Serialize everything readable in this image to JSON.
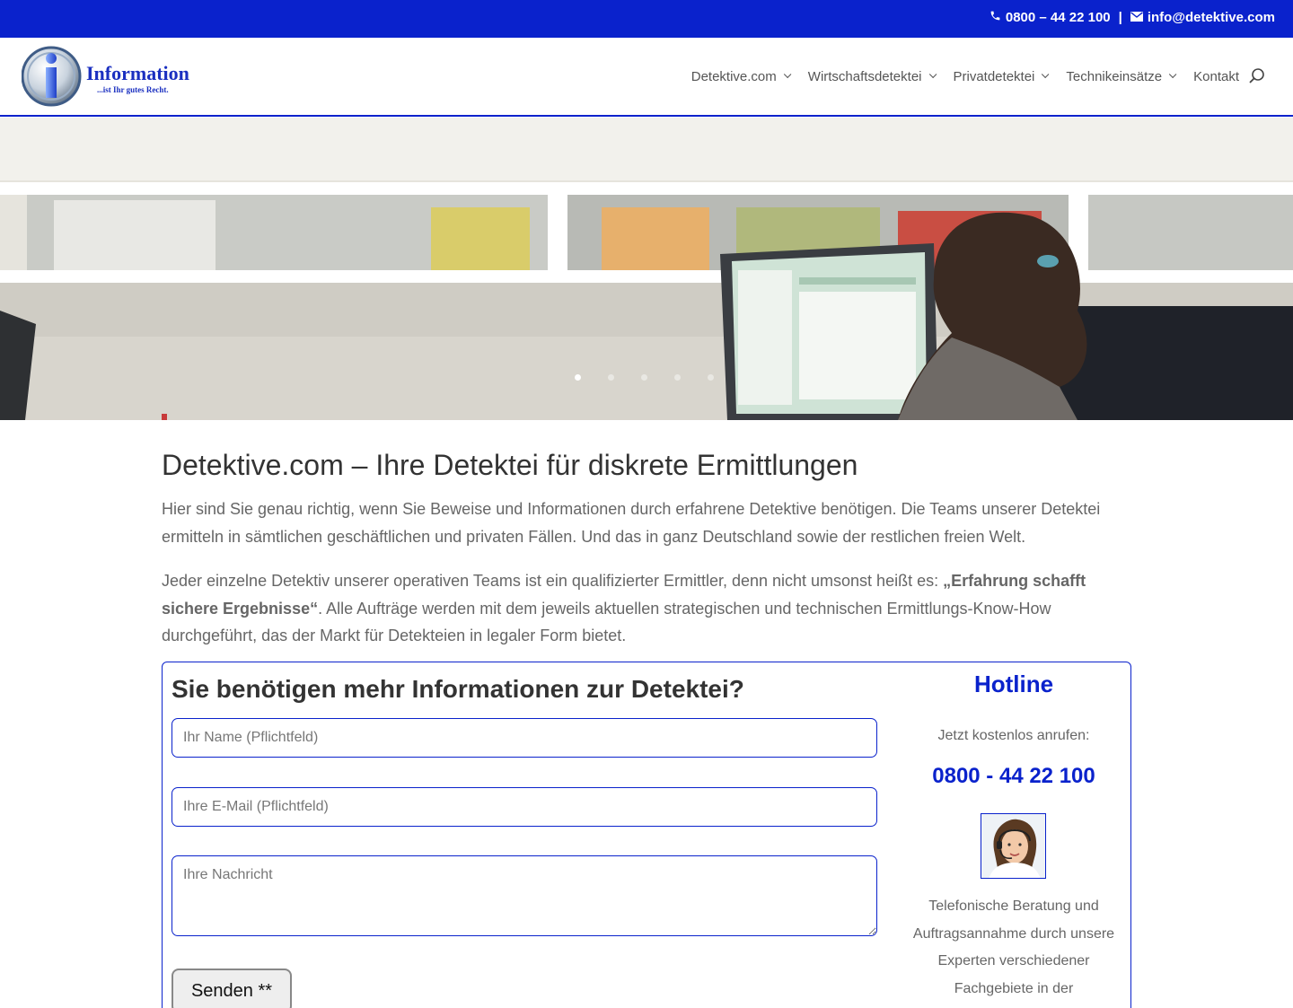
{
  "topbar": {
    "phone": "0800 – 44 22 100",
    "separator": "|",
    "email": "info@detektive.com",
    "phone_icon": "phone-icon",
    "email_icon": "envelope-icon"
  },
  "header": {
    "logo": {
      "word": "Information",
      "tagline": "...ist Ihr gutes Recht."
    },
    "nav": [
      {
        "label": "Detektive.com",
        "has_dropdown": true
      },
      {
        "label": "Wirtschaftsdetektei",
        "has_dropdown": true
      },
      {
        "label": "Privatdetektei",
        "has_dropdown": true
      },
      {
        "label": "Technikeinsätze",
        "has_dropdown": true
      },
      {
        "label": "Kontakt",
        "has_dropdown": false
      }
    ],
    "search_icon": "search-icon"
  },
  "hero": {
    "slides_count": 5,
    "active_slide": 1
  },
  "main": {
    "title": "Detektive.com – Ihre Detektei für diskrete Ermittlungen",
    "para1": "Hier sind Sie genau richtig, wenn Sie Beweise und Informationen durch erfahrene Detektive benötigen. Die Teams unserer Detektei ermitteln in sämtlichen geschäftlichen und privaten Fällen. Und das in ganz Deutschland sowie der restlichen freien Welt.",
    "para2_pre": "Jeder einzelne Detektiv unserer operativen Teams ist ein qualifizierter Ermittler, denn nicht umsonst heißt es: ",
    "para2_bold": "„Erfahrung schafft sichere Ergebnisse“",
    "para2_post": ". Alle Aufträge werden mit dem jeweils aktuellen strategischen und technischen Ermittlungs-Know-How durchgeführt, das der Markt für Detekteien in legaler Form bietet."
  },
  "contact": {
    "title": "Sie benötigen mehr Informationen zur Detektei?",
    "name_placeholder": "Ihr Name (Pflichtfeld)",
    "email_placeholder": "Ihre E-Mail (Pflichtfeld)",
    "message_placeholder": "Ihre Nachricht",
    "send_label": "Senden **"
  },
  "hotline": {
    "title": "Hotline",
    "subtitle": "Jetzt kostenlos anrufen:",
    "phone": "0800 - 44 22 100",
    "text": "Telefonische Beratung und Auftragsannahme durch unsere Experten verschiedener Fachgebiete in der"
  },
  "colors": {
    "brand_blue": "#0a22cc",
    "text": "#666666",
    "heading": "#333333"
  }
}
